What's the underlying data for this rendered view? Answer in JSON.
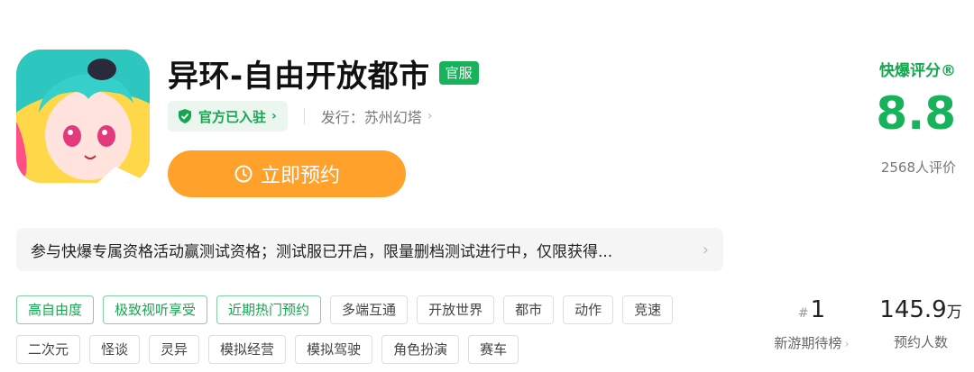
{
  "app": {
    "title": "异环-自由开放都市",
    "official_badge": "官服",
    "verified_label": "官方已入驻",
    "publisher": "发行：苏州幻塔",
    "reserve_label": "立即预约",
    "icon_name": "game-app-icon"
  },
  "rating": {
    "label": "快爆评分®",
    "score": "8.8",
    "count": "2568人评价"
  },
  "notice": {
    "text": "参与快爆专属资格活动赢测试资格；测试服已开启，限量删档测试进行中，仅限获得..."
  },
  "tags": {
    "row1": [
      "高自由度",
      "极致视听享受",
      "近期热门预约",
      "多端互通",
      "开放世界",
      "都市",
      "动作",
      "竞速"
    ],
    "row2": [
      "二次元",
      "怪谈",
      "灵异",
      "模拟经营",
      "模拟驾驶",
      "角色扮演",
      "赛车"
    ]
  },
  "stats": {
    "rank_value": "1",
    "rank_prefix": "#",
    "rank_label": "新游期待榜",
    "reserve_value": "145.9",
    "reserve_unit": "万",
    "reserve_label": "预约人数"
  },
  "colors": {
    "accent_green": "#18b25b",
    "button_orange": "#ffa12b"
  }
}
